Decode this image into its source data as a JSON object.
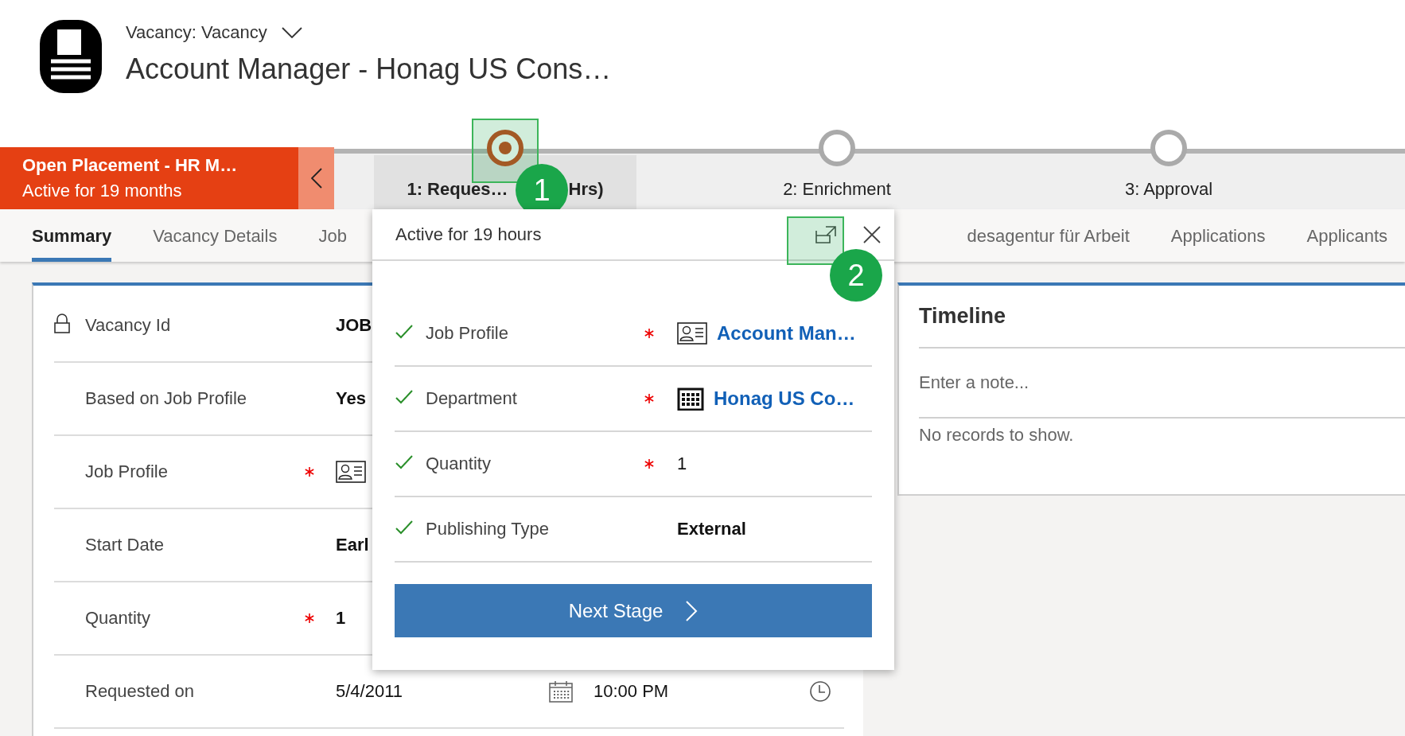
{
  "header": {
    "entity": "Vacancy: Vacancy",
    "title": "Account Manager - Honag US Cons…"
  },
  "process": {
    "active_flow": {
      "name": "Open Placement - HR M…",
      "duration": "Active for 19 months"
    },
    "stages": [
      {
        "label": "1: Reques…",
        "label_tail": "Hrs)",
        "selected": true,
        "callout": "1"
      },
      {
        "label": "2: Enrichment",
        "selected": false
      },
      {
        "label": "3: Approval",
        "selected": false
      }
    ]
  },
  "tabs": [
    {
      "label": "Summary",
      "selected": true
    },
    {
      "label": "Vacancy Details",
      "selected": false
    },
    {
      "label": "Job",
      "selected": false
    },
    {
      "label": "desagentur für Arbeit",
      "selected": false
    },
    {
      "label": "Applications",
      "selected": false
    },
    {
      "label": "Applicants",
      "selected": false
    }
  ],
  "form": {
    "fields": [
      {
        "label": "Vacancy Id",
        "locked": true,
        "required": false,
        "kind": "text",
        "value": "JOB"
      },
      {
        "label": "Based on Job Profile",
        "locked": false,
        "required": false,
        "kind": "text",
        "value": "Yes"
      },
      {
        "label": "Job Profile",
        "locked": false,
        "required": true,
        "kind": "card"
      },
      {
        "label": "Start Date",
        "locked": false,
        "required": false,
        "kind": "text",
        "value": "Earl"
      },
      {
        "label": "Quantity",
        "locked": false,
        "required": true,
        "kind": "text",
        "value": "1"
      },
      {
        "label": "Requested on",
        "locked": false,
        "required": false,
        "kind": "datetime",
        "date": "5/4/2011",
        "time": "10:00 PM"
      }
    ]
  },
  "flyout": {
    "title": "Active for 19 hours",
    "expand_callout": "2",
    "steps": [
      {
        "label": "Job Profile",
        "complete": true,
        "required": true,
        "kind": "card",
        "value": "Account Man…"
      },
      {
        "label": "Department",
        "complete": true,
        "required": true,
        "kind": "building",
        "value": "Honag US Co…"
      },
      {
        "label": "Quantity",
        "complete": true,
        "required": true,
        "kind": "text",
        "value": "1"
      },
      {
        "label": "Publishing Type",
        "complete": true,
        "required": false,
        "kind": "text",
        "value": "External"
      }
    ],
    "button": "Next Stage"
  },
  "timeline": {
    "title": "Timeline",
    "placeholder": "Enter a note...",
    "empty": "No records to show."
  }
}
